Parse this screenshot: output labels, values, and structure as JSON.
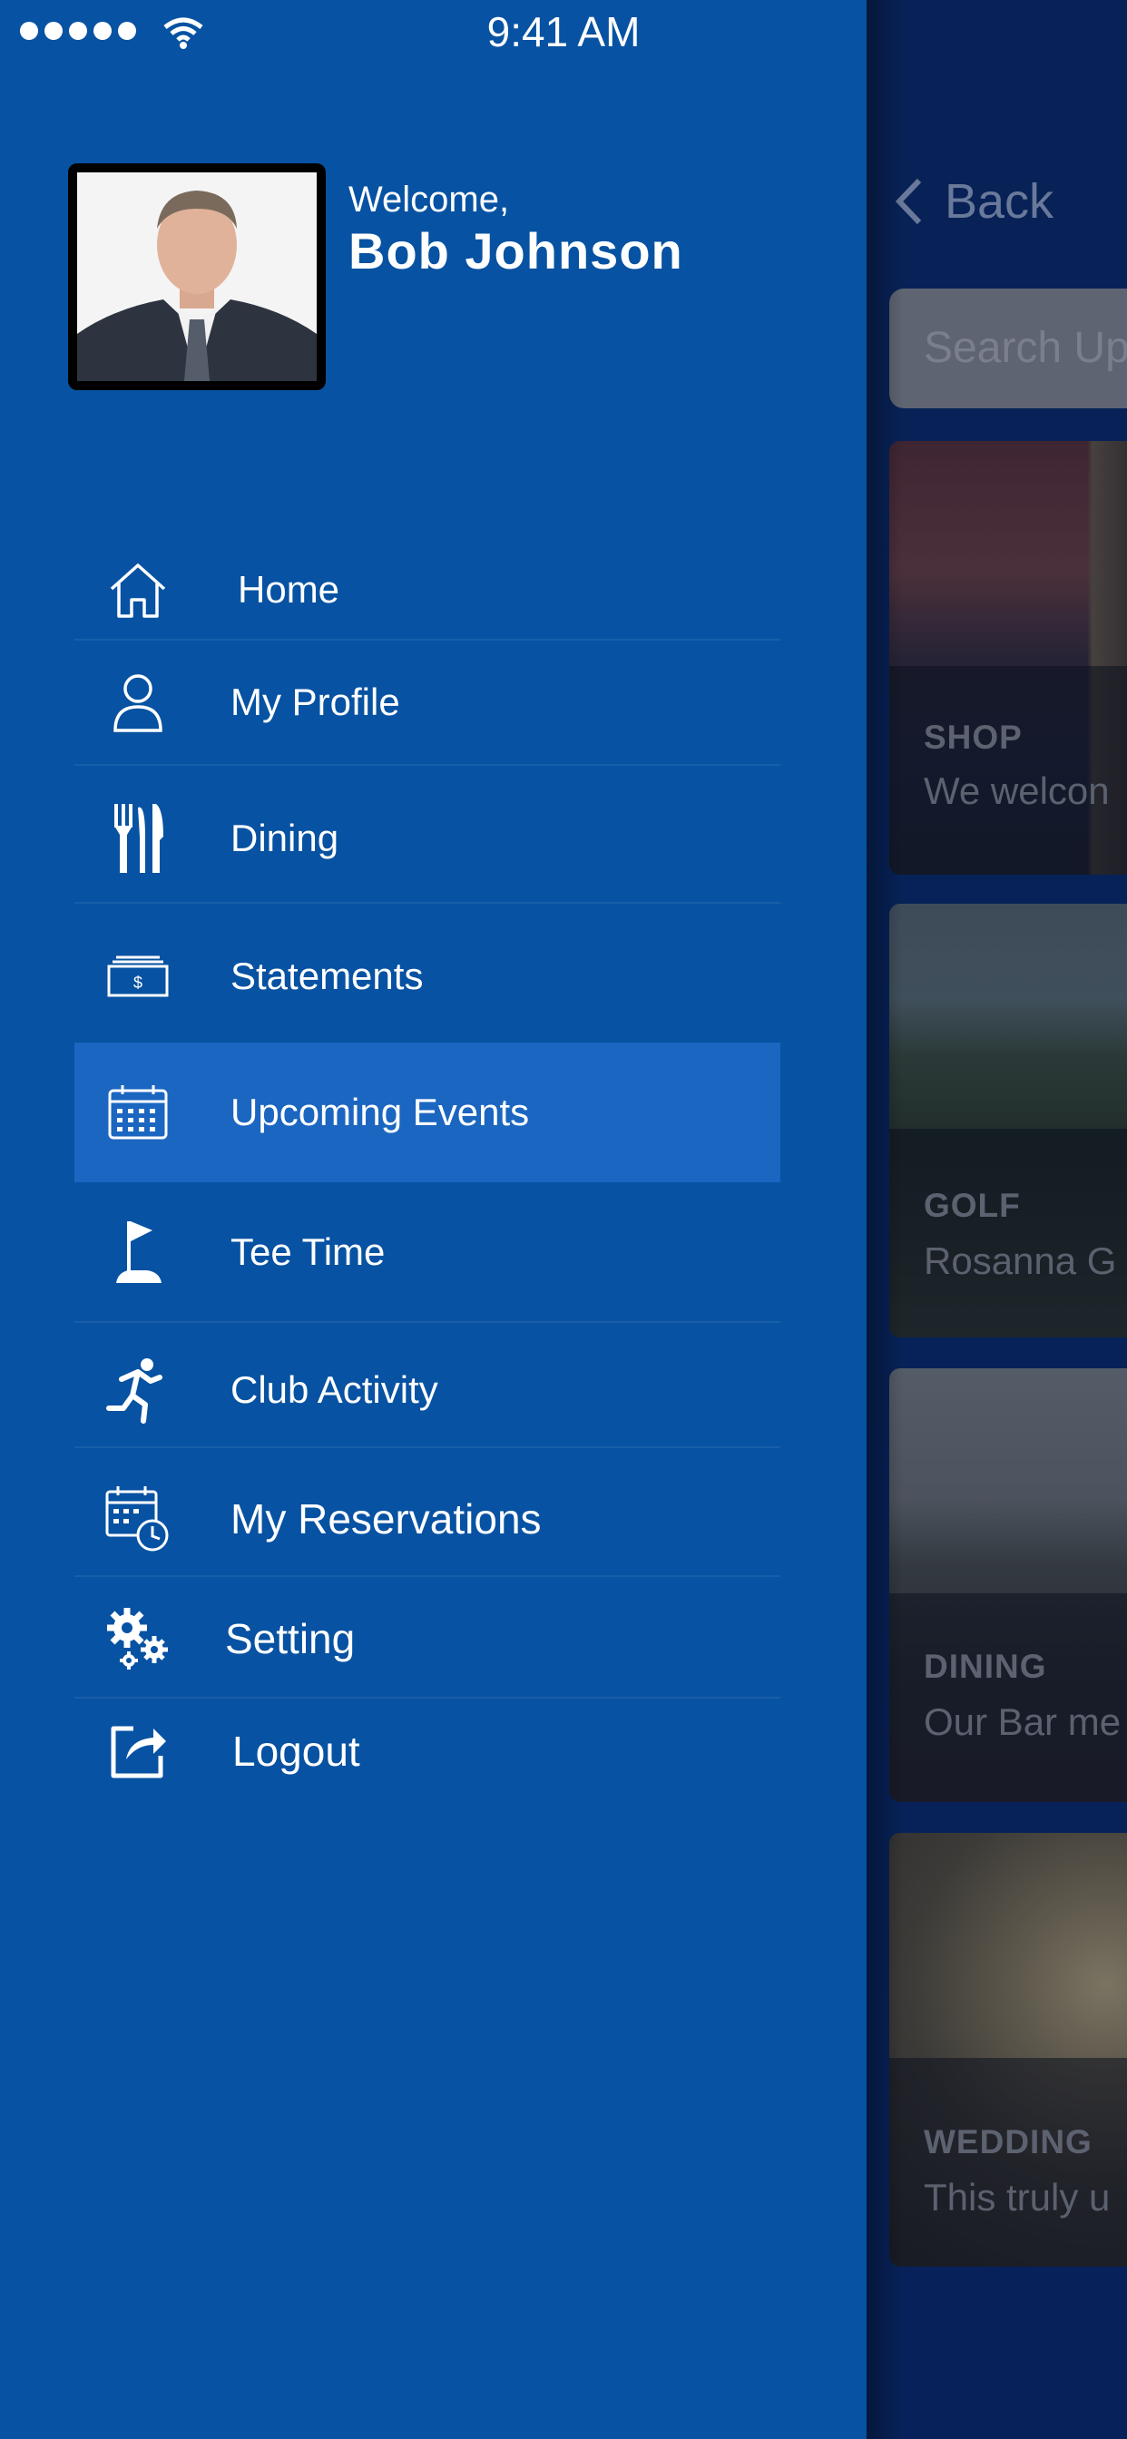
{
  "status_bar": {
    "time": "9:41 AM"
  },
  "header": {
    "welcome": "Welcome,",
    "name": "Bob Johnson"
  },
  "menu": {
    "items": [
      {
        "label": "Home",
        "icon": "home-icon"
      },
      {
        "label": "My Profile",
        "icon": "user-icon"
      },
      {
        "label": "Dining",
        "icon": "cutlery-icon"
      },
      {
        "label": "Statements",
        "icon": "money-icon"
      },
      {
        "label": "Upcoming Events",
        "icon": "calendar-icon",
        "active": true
      },
      {
        "label": "Tee Time",
        "icon": "flag-icon"
      },
      {
        "label": "Club Activity",
        "icon": "runner-icon"
      },
      {
        "label": "My Reservations",
        "icon": "calendar-clock-icon"
      },
      {
        "label": "Setting",
        "icon": "gears-icon"
      },
      {
        "label": "Logout",
        "icon": "share-icon"
      }
    ]
  },
  "background": {
    "back_label": "Back",
    "search_placeholder": "Search Up",
    "cards": [
      {
        "category": "SHOP",
        "description": "We welcon"
      },
      {
        "category": "GOLF",
        "description": "Rosanna G"
      },
      {
        "category": "DINING",
        "description": "Our Bar me"
      },
      {
        "category": "WEDDING",
        "description": "This truly u"
      }
    ]
  },
  "colors": {
    "menu_bg": "#0752a2",
    "active_item": "#1b66c0",
    "backdrop": "#0a2a66"
  }
}
